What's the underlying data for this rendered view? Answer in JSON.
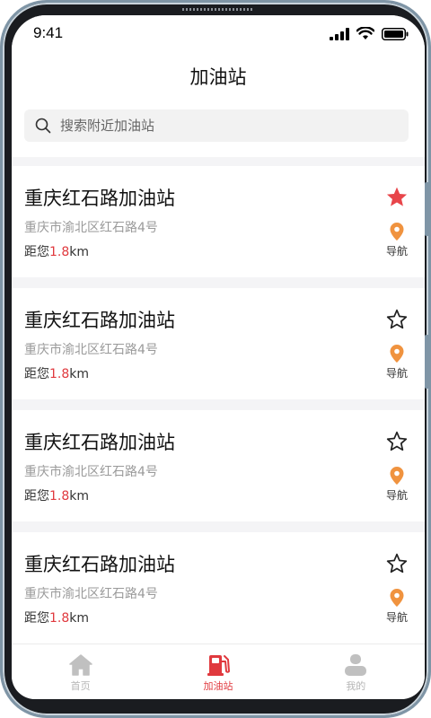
{
  "status_bar": {
    "time": "9:41"
  },
  "header": {
    "title": "加油站"
  },
  "search": {
    "placeholder": "搜索附近加油站"
  },
  "stations": [
    {
      "name": "重庆红石路加油站",
      "address": "重庆市渝北区红石路4号",
      "distance_prefix": "距您",
      "distance_value": "1.8",
      "distance_unit": "km",
      "favorited": true,
      "nav_label": "导航"
    },
    {
      "name": "重庆红石路加油站",
      "address": "重庆市渝北区红石路4号",
      "distance_prefix": "距您",
      "distance_value": "1.8",
      "distance_unit": "km",
      "favorited": false,
      "nav_label": "导航"
    },
    {
      "name": "重庆红石路加油站",
      "address": "重庆市渝北区红石路4号",
      "distance_prefix": "距您",
      "distance_value": "1.8",
      "distance_unit": "km",
      "favorited": false,
      "nav_label": "导航"
    },
    {
      "name": "重庆红石路加油站",
      "address": "重庆市渝北区红石路4号",
      "distance_prefix": "距您",
      "distance_value": "1.8",
      "distance_unit": "km",
      "favorited": false,
      "nav_label": "导航"
    }
  ],
  "tabbar": {
    "tabs": [
      {
        "label": "首页",
        "icon": "home-icon",
        "active": false
      },
      {
        "label": "加油站",
        "icon": "fuel-pump-icon",
        "active": true
      },
      {
        "label": "我的",
        "icon": "user-icon",
        "active": false
      }
    ]
  },
  "colors": {
    "accent": "#e0393e",
    "star_filled": "#e8454a",
    "nav_pin": "#f0933f",
    "tab_inactive": "#c0c0c0"
  }
}
